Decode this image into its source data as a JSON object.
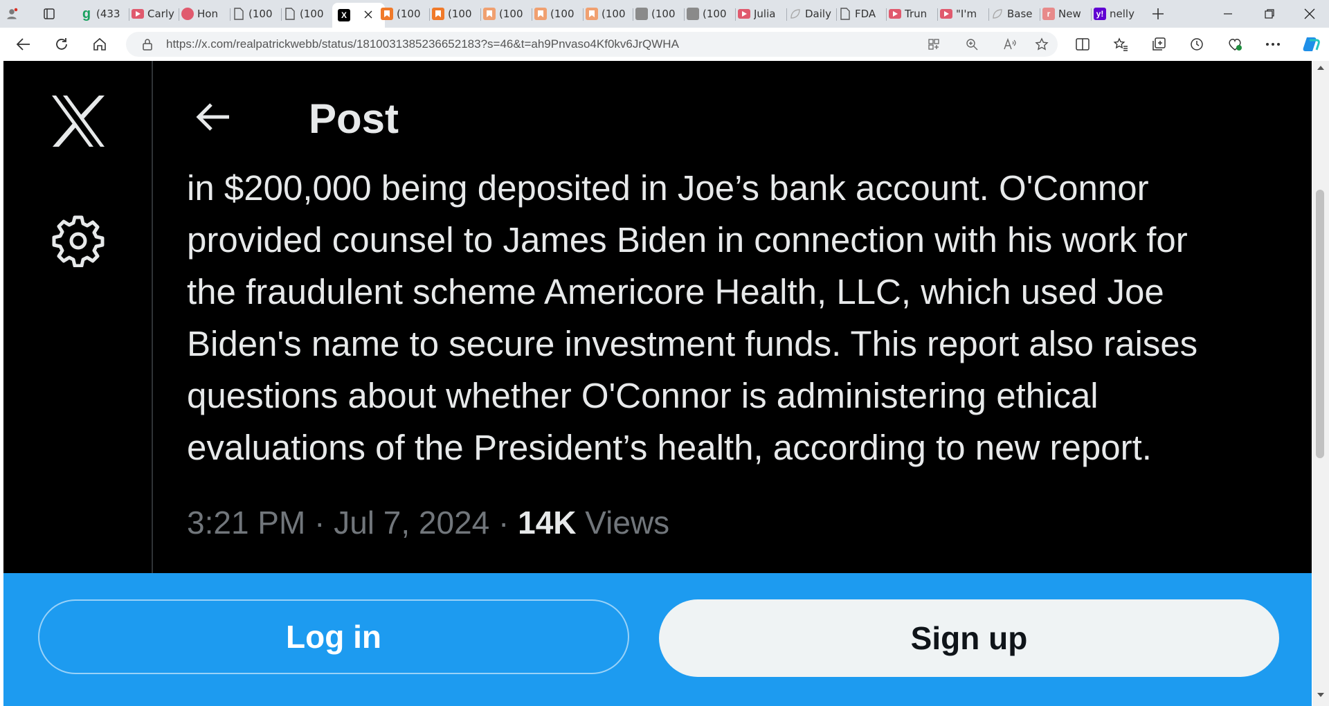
{
  "browser": {
    "tabs": [
      {
        "label": "",
        "icon": "profile-icon",
        "color": "#7a7a7a"
      },
      {
        "label": "",
        "icon": "tab-actions-icon",
        "color": "#333333"
      },
      {
        "label": "(433",
        "icon": "g-icon",
        "color": "#1aa260"
      },
      {
        "label": "Carly",
        "icon": "youtube-icon",
        "color": "#e05a6e"
      },
      {
        "label": "Hon",
        "icon": "podcast-icon",
        "color": "#e05a6e"
      },
      {
        "label": "(100",
        "icon": "page-icon",
        "color": "#555555"
      },
      {
        "label": "(100",
        "icon": "page-icon",
        "color": "#555555"
      },
      {
        "label": "",
        "icon": "x-icon",
        "color": "#000000"
      },
      {
        "label": "(100",
        "icon": "bookmark-icon",
        "color": "#f07a2a"
      },
      {
        "label": "(100",
        "icon": "bookmark-icon",
        "color": "#f07a2a"
      },
      {
        "label": "(100",
        "icon": "bookmark-icon",
        "color": "#f0a070"
      },
      {
        "label": "(100",
        "icon": "bookmark-icon",
        "color": "#f0a070"
      },
      {
        "label": "(100",
        "icon": "bookmark-icon",
        "color": "#f0a070"
      },
      {
        "label": "(100",
        "icon": "image-icon",
        "color": "#8a8a8a"
      },
      {
        "label": "(100",
        "icon": "image-icon",
        "color": "#8a8a8a"
      },
      {
        "label": "Julia",
        "icon": "youtube-icon",
        "color": "#e05a6e"
      },
      {
        "label": "Daily",
        "icon": "leaf-icon",
        "color": "#aaaaaa"
      },
      {
        "label": "FDA",
        "icon": "page-icon",
        "color": "#555555"
      },
      {
        "label": "Trun",
        "icon": "youtube-icon",
        "color": "#e05a6e"
      },
      {
        "label": "\"I'm",
        "icon": "youtube-icon",
        "color": "#e05a6e"
      },
      {
        "label": "Base",
        "icon": "leaf-icon",
        "color": "#aaaaaa"
      },
      {
        "label": "New",
        "icon": "r-icon",
        "color": "#e88a8a"
      },
      {
        "label": "nelly",
        "icon": "yahoo-icon",
        "color": "#6001d2"
      }
    ],
    "url": "https://x.com/realpatrickwebb/status/1810031385236652183?s=46&t=ah9Pnvaso4Kf0kv6JrQWHA"
  },
  "page": {
    "header_title": "Post",
    "tweet_lines": [
      "in $200,000 being deposited in Joe’s bank account. O'Connor",
      "provided counsel to James Biden in connection with his work for",
      "the fraudulent scheme Americore Health, LLC, which used Joe",
      "Biden's name to secure investment funds. This report also raises",
      "questions about whether O'Connor is administering ethical",
      "evaluations of the President’s health, according to new report."
    ],
    "timestamp": "3:21 PM · Jul 7, 2024 · ",
    "views_count": "14K",
    "views_label": " Views",
    "login_label": "Log in",
    "signup_label": "Sign up",
    "banner_color": "#1d9bf0"
  }
}
